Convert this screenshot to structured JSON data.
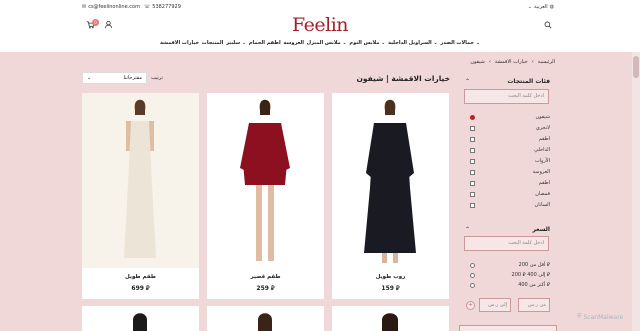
{
  "header": {
    "email": "cs@feelinonline.com",
    "phone": "538277929",
    "logo": "Feelin",
    "language": "العربية"
  },
  "cart": {
    "count": "0"
  },
  "nav": [
    "حمالات الصدر",
    "السراويل الداخلية",
    "ملابس النوم",
    "ملابس المنزل",
    "العروسة",
    "اطقم الحمام",
    "سليبز",
    "المنتجات",
    "خيارات الاقمشة"
  ],
  "breadcrumb": [
    "الرئيسية",
    "خيارات الاقمشة",
    "شيفون"
  ],
  "page_title": "خيارات الاقمشة | شيفون",
  "sort": {
    "label": "ترتيب",
    "value": "مقترحاتنا"
  },
  "filters": {
    "categories_title": "فئات المنتجات",
    "search_placeholder": "ادخل كلمة البحث",
    "categories": [
      "شيفون",
      "لانجري",
      "اطقم",
      "الداخلي",
      "الأرواب",
      "العروسة",
      "اطقم",
      "قمصان",
      "الساتان"
    ],
    "price_title": "السعر",
    "price_placeholder": "ادخل كلمة البحث",
    "price_ranges": [
      "أقل من 200 ⃁",
      "200 ⃁ إلى 400 ⃁",
      "أكثر من 400 ⃁"
    ],
    "price_from_placeholder": "من ر.س",
    "price_to_placeholder": "إلى ر.س",
    "go_label": "+"
  },
  "products": [
    {
      "name": "روب طويل",
      "price": "159 ⃁",
      "color": "#1a1a22"
    },
    {
      "name": "طقم قصير",
      "price": "259 ⃁",
      "color": "#8c1020"
    },
    {
      "name": "طقم طويل",
      "price": "699 ⃁",
      "color": "#ece4d6"
    }
  ],
  "watermark": "ScanMalware"
}
